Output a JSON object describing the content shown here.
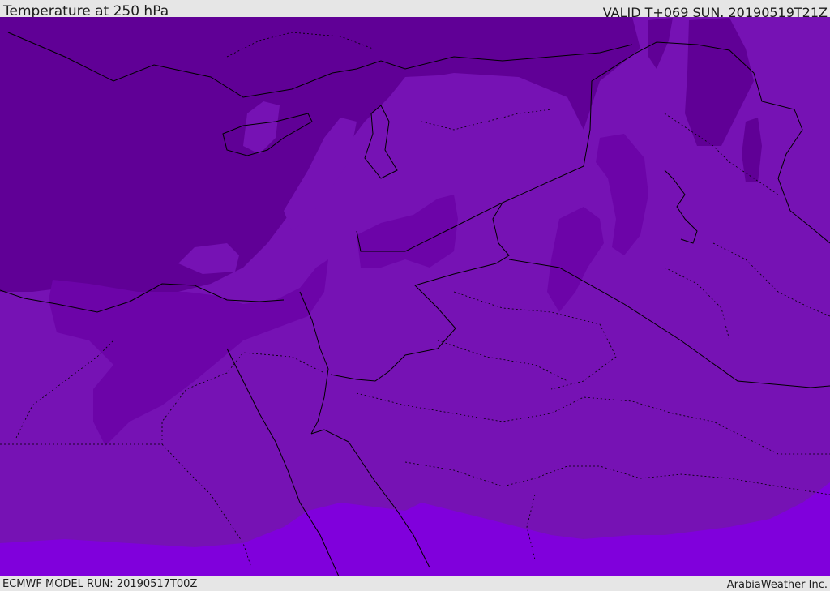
{
  "header": {
    "title": "Temperature at 250 hPa",
    "valid_time": "VALID T+069 SUN. 20190519T21Z"
  },
  "footer": {
    "model_run": "ECMWF MODEL RUN: 20190517T00Z",
    "credit": "ArabiaWeather Inc."
  },
  "colors": {
    "band_dark": "#600096",
    "band_mid_dark": "#6c04a8",
    "band_mid": "#7612b4",
    "band_light": "#8000dc",
    "border_line": "#000000",
    "frame": "#e6e6e6"
  }
}
